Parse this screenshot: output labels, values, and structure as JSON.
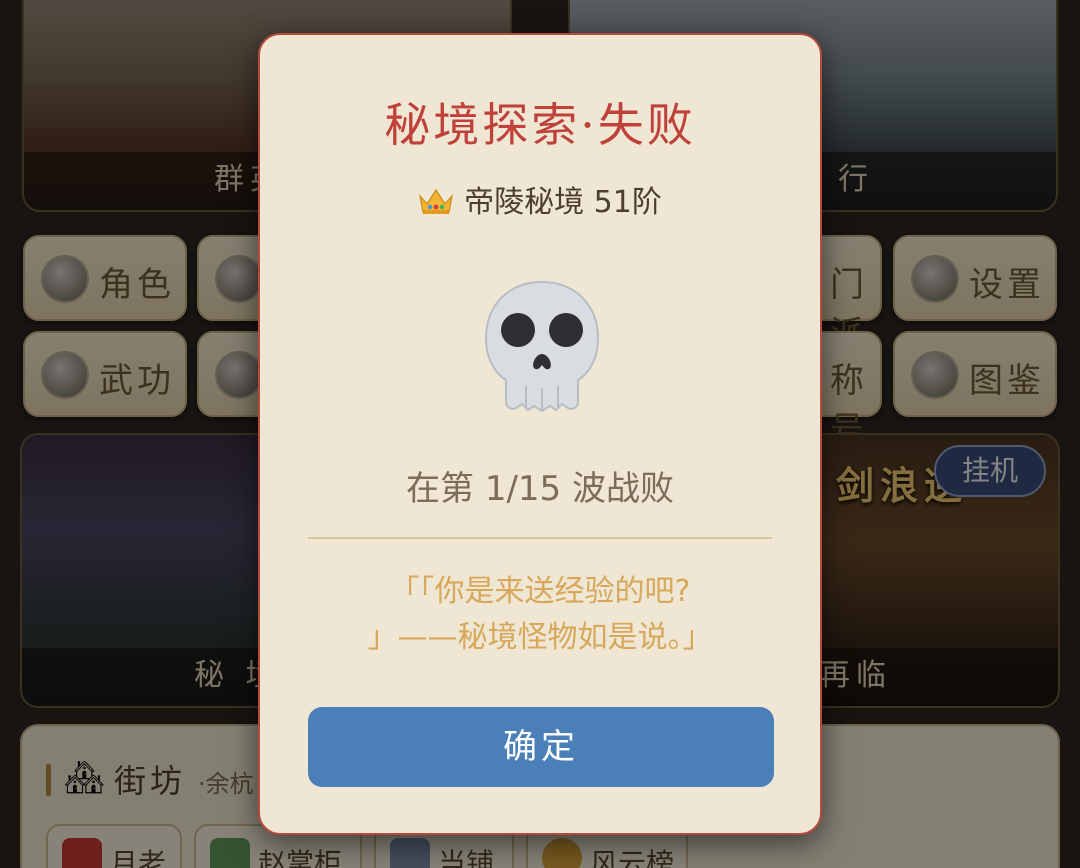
{
  "background": {
    "banners": {
      "top_left_caption": "群英",
      "top_right_caption": "行",
      "mid_left_caption": "秘 境",
      "mid_right_caption": "再临",
      "mid_right_deco_title": "剑浪逆",
      "idle_badge": "挂机"
    },
    "menu": {
      "role": "角色",
      "faction": "门派",
      "settings": "设置",
      "martial": "武功",
      "title": "称号",
      "codex": "图鉴"
    },
    "street": {
      "title": "街坊",
      "subtitle": "·余杭",
      "chips": [
        "月老",
        "赵掌柜",
        "当铺",
        "风云榜"
      ]
    }
  },
  "modal": {
    "title": "秘境探索·失败",
    "dungeon_name": "帝陵秘境 51阶",
    "defeat_text": "在第 1/15 波战败",
    "quote_line1": "「「你是来送经验的吧?",
    "quote_line2": "」——秘境怪物如是说。」",
    "confirm_label": "确定"
  },
  "colors": {
    "title_red": "#c0413a",
    "quote_gold": "#d7a85a",
    "confirm_blue": "#4a7fb8",
    "modal_bg": "#efe6d4"
  }
}
